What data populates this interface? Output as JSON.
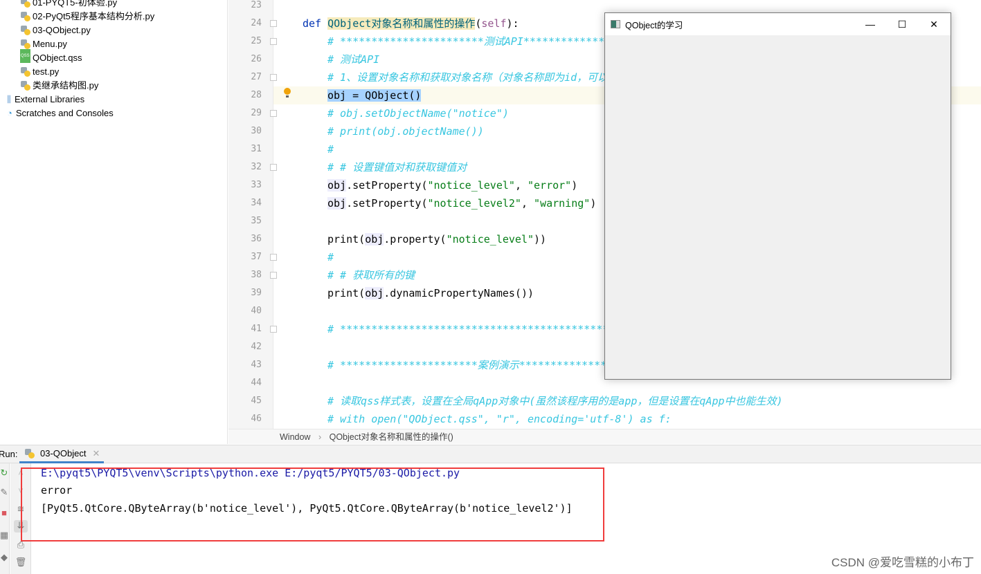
{
  "project_tree": {
    "items": [
      {
        "label": "01-PYQT5-初体验.py",
        "icon": "python-file-icon"
      },
      {
        "label": "02-PyQt5程序基本结构分析.py",
        "icon": "python-file-icon"
      },
      {
        "label": "03-QObject.py",
        "icon": "python-file-icon"
      },
      {
        "label": "Menu.py",
        "icon": "python-file-icon"
      },
      {
        "label": "QObject.qss",
        "icon": "qss-file-icon"
      },
      {
        "label": "test.py",
        "icon": "python-file-icon"
      },
      {
        "label": "类继承结构图.py",
        "icon": "python-file-icon"
      },
      {
        "label": "External Libraries",
        "icon": "library-icon"
      },
      {
        "label": "Scratches and Consoles",
        "icon": "scratches-icon"
      }
    ]
  },
  "editor": {
    "current_line": 28,
    "lines": [
      {
        "n": "23",
        "parts": []
      },
      {
        "n": "24",
        "parts": [
          [
            "kw",
            "def "
          ],
          [
            "fn",
            "QObject对象名称和属性的操作"
          ],
          [
            "pl",
            "("
          ],
          [
            "self",
            "self"
          ],
          [
            "pl",
            "):"
          ]
        ],
        "indent": 0,
        "fold": true
      },
      {
        "n": "25",
        "parts": [
          [
            "cm",
            "# ***********************测试API*************"
          ]
        ],
        "fold": true
      },
      {
        "n": "26",
        "parts": [
          [
            "cm",
            "# 测试API"
          ]
        ]
      },
      {
        "n": "27",
        "parts": [
          [
            "cm",
            "# 1、设置对象名称和获取对象名称（对象名称即为id，可以"
          ]
        ],
        "fold": true
      },
      {
        "n": "28",
        "parts": [
          [
            "sel",
            "obj = QObject()"
          ]
        ]
      },
      {
        "n": "29",
        "parts": [
          [
            "cm",
            "# obj.setObjectName(\"notice\")"
          ]
        ],
        "fold": true
      },
      {
        "n": "30",
        "parts": [
          [
            "cm",
            "# print(obj.objectName())"
          ]
        ]
      },
      {
        "n": "31",
        "parts": [
          [
            "cm",
            "#"
          ]
        ]
      },
      {
        "n": "32",
        "parts": [
          [
            "cm",
            "# # 设置键值对和获取键值对"
          ]
        ],
        "fold": true
      },
      {
        "n": "33",
        "parts": [
          [
            "ob",
            "obj"
          ],
          [
            "pl",
            ".setProperty("
          ],
          [
            "st",
            "\"notice_level\""
          ],
          [
            "pl",
            ", "
          ],
          [
            "st",
            "\"error\""
          ],
          [
            "pl",
            ")"
          ]
        ]
      },
      {
        "n": "34",
        "parts": [
          [
            "ob",
            "obj"
          ],
          [
            "pl",
            ".setProperty("
          ],
          [
            "st",
            "\"notice_level2\""
          ],
          [
            "pl",
            ", "
          ],
          [
            "st",
            "\"warning\""
          ],
          [
            "pl",
            ")"
          ]
        ]
      },
      {
        "n": "35",
        "parts": []
      },
      {
        "n": "36",
        "parts": [
          [
            "pl",
            "print("
          ],
          [
            "ob",
            "obj"
          ],
          [
            "pl",
            ".property("
          ],
          [
            "st",
            "\"notice_level\""
          ],
          [
            "pl",
            "))"
          ]
        ]
      },
      {
        "n": "37",
        "parts": [
          [
            "cm",
            "#"
          ]
        ],
        "fold": true
      },
      {
        "n": "38",
        "parts": [
          [
            "cm",
            "# # 获取所有的键"
          ]
        ],
        "fold": true
      },
      {
        "n": "39",
        "parts": [
          [
            "pl",
            "print("
          ],
          [
            "ob",
            "obj"
          ],
          [
            "pl",
            ".dynamicPropertyNames())"
          ]
        ]
      },
      {
        "n": "40",
        "parts": []
      },
      {
        "n": "41",
        "parts": [
          [
            "cm",
            "# ********************************************"
          ]
        ],
        "fold": true
      },
      {
        "n": "42",
        "parts": []
      },
      {
        "n": "43",
        "parts": [
          [
            "cm",
            "# **********************案例演示**************"
          ]
        ]
      },
      {
        "n": "44",
        "parts": []
      },
      {
        "n": "45",
        "parts": [
          [
            "cm",
            "# 读取qss样式表，设置在全局qApp对象中(虽然该程序用的是app，但是设置在qApp中也能生效)"
          ]
        ]
      },
      {
        "n": "46",
        "parts": [
          [
            "cm",
            "# with open(\"QObject.qss\", \"r\", encoding='utf-8') as f:"
          ]
        ]
      }
    ]
  },
  "breadcrumb": [
    "Window",
    "QObject对象名称和属性的操作()"
  ],
  "run": {
    "label": "Run:",
    "tab": "03-QObject",
    "output": [
      {
        "text": "E:\\pyqt5\\PYQT5\\venv\\Scripts\\python.exe E:/pyqt5/PYQT5/03-QObject.py",
        "color": "#1a1aa6"
      },
      {
        "text": "error",
        "color": "#080808"
      },
      {
        "text": "[PyQt5.QtCore.QByteArray(b'notice_level'), PyQt5.QtCore.QByteArray(b'notice_level2')]",
        "color": "#080808"
      }
    ]
  },
  "qt_window": {
    "title": "QObject的学习"
  },
  "watermark": "CSDN @爱吃雪糕的小布丁",
  "colors": {
    "highlight_box": "#f03c3c",
    "comment": "#38c6e0",
    "keyword": "#0033b3",
    "string": "#067d17"
  }
}
